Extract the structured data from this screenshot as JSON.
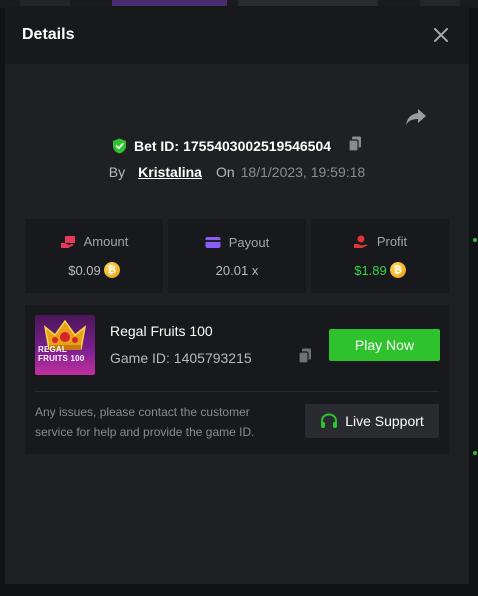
{
  "modal": {
    "title": "Details"
  },
  "bet": {
    "label": "Bet ID:",
    "id": "1755403002519546504",
    "by_label": "By",
    "user": "Kristalina",
    "on_label": "On",
    "date": "18/1/2023, 19:59:18"
  },
  "stats": {
    "amount": {
      "label": "Amount",
      "value": "$0.09"
    },
    "payout": {
      "label": "Payout",
      "value": "20.01 x"
    },
    "profit": {
      "label": "Profit",
      "value": "$1.89"
    }
  },
  "game": {
    "name": "Regal Fruits 100",
    "id_label": "Game ID:",
    "id": "1405793215",
    "play_label": "Play Now"
  },
  "support": {
    "text": "Any issues, please contact the customer service for help and provide the game ID.",
    "button_label": "Live Support"
  },
  "colors": {
    "accent_green": "#2ec22d",
    "profit_green": "#38d348",
    "amount_icon": "#e8385a",
    "payout_icon": "#8b5cf6",
    "profit_icon": "#e0343b",
    "coin": "#f2a81c"
  },
  "icons": {
    "close": "close-icon",
    "share": "share-icon",
    "verified": "shield-check-icon",
    "copy": "copy-icon",
    "amount": "money-hand-icon",
    "payout": "wallet-icon",
    "profit": "hand-coin-icon",
    "coin": "coin-icon",
    "headset": "headset-icon"
  }
}
